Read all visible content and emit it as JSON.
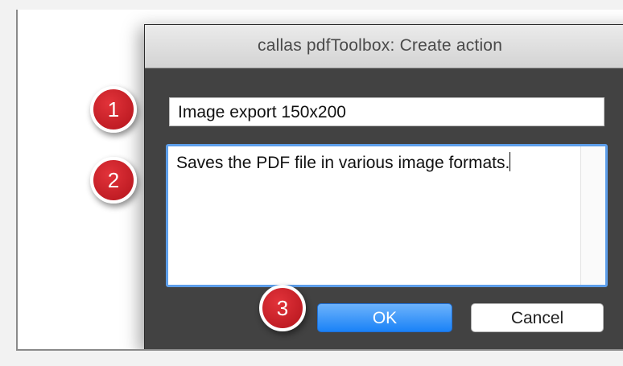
{
  "dialog": {
    "title": "callas pdfToolbox: Create action",
    "name_value": "Image export 150x200",
    "description_value": "Saves the PDF file in various image formats.",
    "ok_label": "OK",
    "cancel_label": "Cancel"
  },
  "callouts": [
    "1",
    "2",
    "3"
  ],
  "colors": {
    "badge": "#c41a22",
    "ok_button": "#1a82f7",
    "focus_ring": "#5d9eea",
    "dialog_body": "#424242"
  }
}
